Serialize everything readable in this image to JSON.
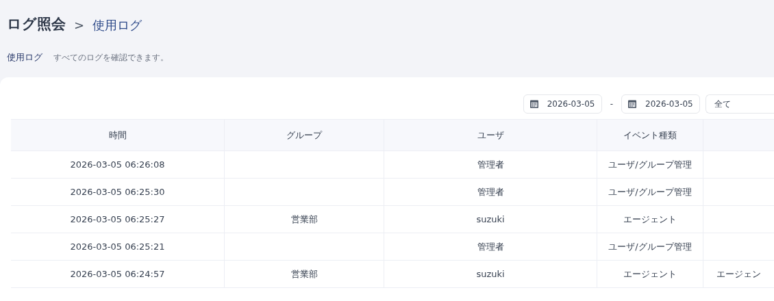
{
  "breadcrumb": {
    "parent": "ログ照会",
    "separator": ">",
    "current": "使用ログ"
  },
  "section": {
    "title": "使用ログ",
    "description": "すべてのログを確認できます。"
  },
  "filters": {
    "date_from": "2026-03-05",
    "range_separator": "-",
    "date_to": "2026-03-05",
    "type_select": "全て"
  },
  "table": {
    "columns": [
      "時間",
      "グループ",
      "ユーザ",
      "イベント種類"
    ],
    "rows": [
      {
        "cells": [
          "2026-03-05 06:26:08",
          null,
          "管理者",
          "ユーザ/グループ管理",
          null
        ]
      },
      {
        "cells": [
          "2026-03-05 06:25:30",
          null,
          "管理者",
          "ユーザ/グループ管理",
          null
        ]
      },
      {
        "cells": [
          "2026-03-05 06:25:27",
          "営業部",
          "suzuki",
          "エージェント",
          null
        ]
      },
      {
        "cells": [
          "2026-03-05 06:25:21",
          null,
          "管理者",
          "ユーザ/グループ管理",
          null
        ]
      },
      {
        "cells": [
          "2026-03-05 06:24:57",
          "営業部",
          "suzuki",
          "エージェント",
          "エージェン"
        ]
      }
    ]
  }
}
